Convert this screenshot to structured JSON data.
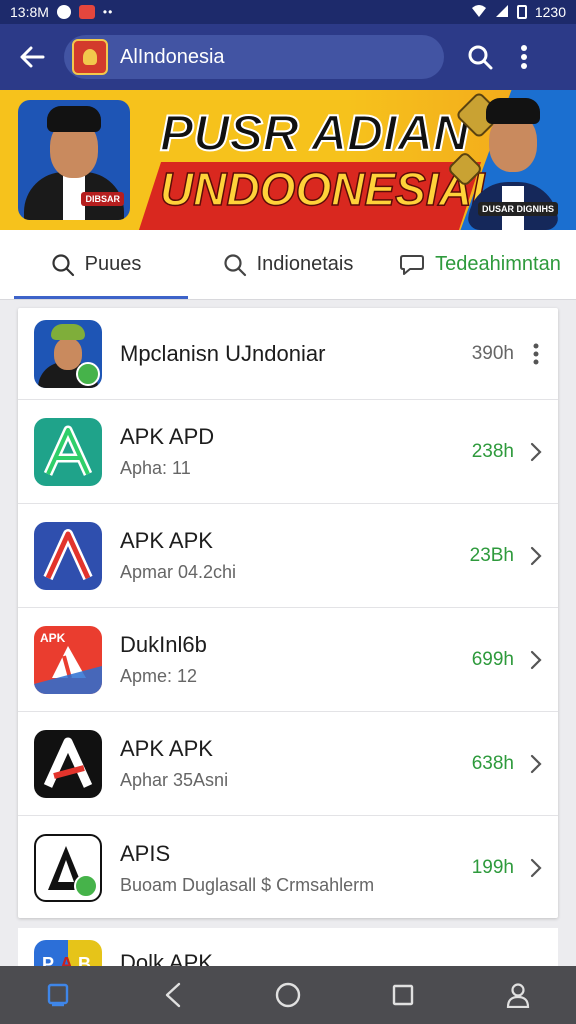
{
  "status_bar": {
    "time": "13:8M",
    "right_text": "1230"
  },
  "app_bar": {
    "title": "ꀀ ALIndonesia",
    "search_text": "AlIndonesia"
  },
  "banner": {
    "line1": "PUSR ADIAN",
    "line2": "UNDOONESIAI",
    "left_tag": "DIBSAR",
    "right_tag": "DUSAR\nDIGNIHS"
  },
  "tabs": [
    {
      "label": "Puues",
      "icon": "search-icon",
      "active": true
    },
    {
      "label": "Indionetais",
      "icon": "search-icon",
      "active": false
    },
    {
      "label": "Tedeahimntan",
      "icon": "chat-bubble-icon",
      "active": false
    }
  ],
  "apps": [
    {
      "title": "Mpclanisn UJndoniar",
      "subtitle": "",
      "meta": "390h",
      "icon": "person-icon",
      "trailing": "more-vert-icon"
    },
    {
      "title": "APK APD",
      "subtitle": "Apha: 11",
      "meta": "238h",
      "icon": "letter-a-green-icon",
      "trailing": "chevron-right-icon"
    },
    {
      "title": "APK APK",
      "subtitle": "Apmar 04.2chi",
      "meta": "23Bh",
      "icon": "letter-a-blue-icon",
      "trailing": "chevron-right-icon"
    },
    {
      "title": "DukInl6b",
      "subtitle": "Apme: 12",
      "meta": "699h",
      "icon": "apk-red-icon",
      "trailing": "chevron-right-icon"
    },
    {
      "title": "APK APK",
      "subtitle": "Aphar 35Asni",
      "meta": "638h",
      "icon": "letter-a-black-icon",
      "trailing": "chevron-right-icon"
    },
    {
      "title": "APIS",
      "subtitle": "Buoam Duglasall $ Crmsahlerm",
      "meta": "199h",
      "icon": "letter-a-outline-icon",
      "trailing": "chevron-right-icon"
    }
  ],
  "partial_row": {
    "title": "Dolk APK",
    "icon": "pab-icon",
    "meta": ""
  },
  "nav": [
    "recent-apps-icon",
    "back-icon",
    "home-icon",
    "overview-icon",
    "profile-icon"
  ],
  "colors": {
    "status_bg": "#1d2a6b",
    "appbar_bg": "#2c3a88",
    "accent_green": "#2e9a3c",
    "tab_indicator": "#3d63c9",
    "nav_bg": "#4c4c50"
  }
}
